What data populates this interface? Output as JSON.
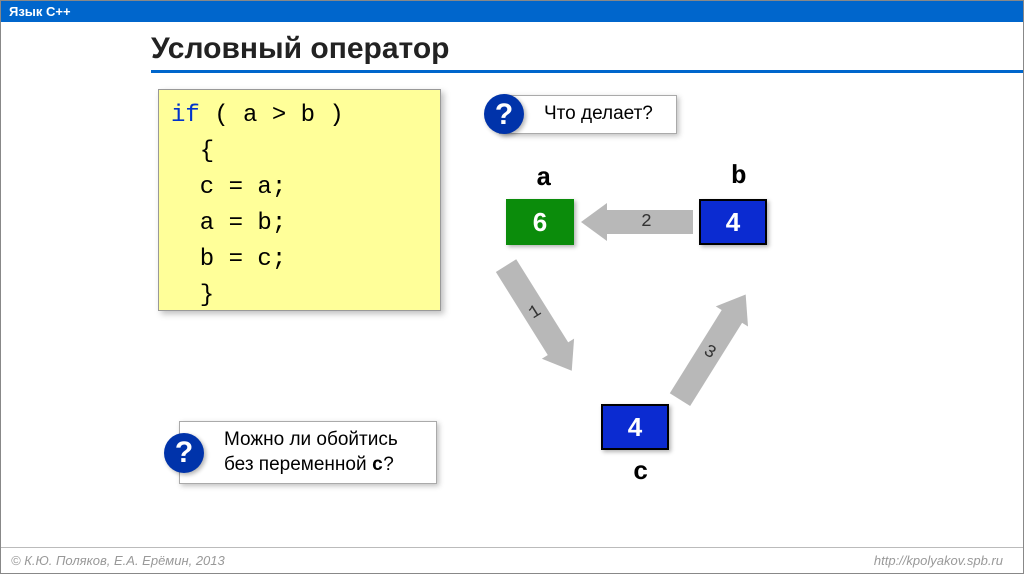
{
  "header": {
    "topbar": "Язык C++",
    "title": "Условный оператор"
  },
  "code": {
    "kw_if": "if",
    "cond": " ( a > b )",
    "l2": "  {",
    "l3": "  c = a;",
    "l4": "  a = b;",
    "l5": "  b = c;",
    "l6": "  }"
  },
  "callouts": {
    "q_icon": "?",
    "q1": "Что делает?",
    "q2_line1": "Можно ли обойтись",
    "q2_line2_prefix": "без переменной ",
    "q2_var": "c",
    "q2_line2_suffix": "?"
  },
  "diagram": {
    "labels": {
      "a": "a",
      "b": "b",
      "c": "c"
    },
    "values": {
      "a": "6",
      "b": "4",
      "c": "4"
    },
    "arrows": {
      "n1": "1",
      "n2": "2",
      "n3": "3"
    }
  },
  "footer": {
    "copyright": "© К.Ю. Поляков, Е.А. Ерёмин, 2013",
    "url": "http://kpolyakov.spb.ru"
  }
}
